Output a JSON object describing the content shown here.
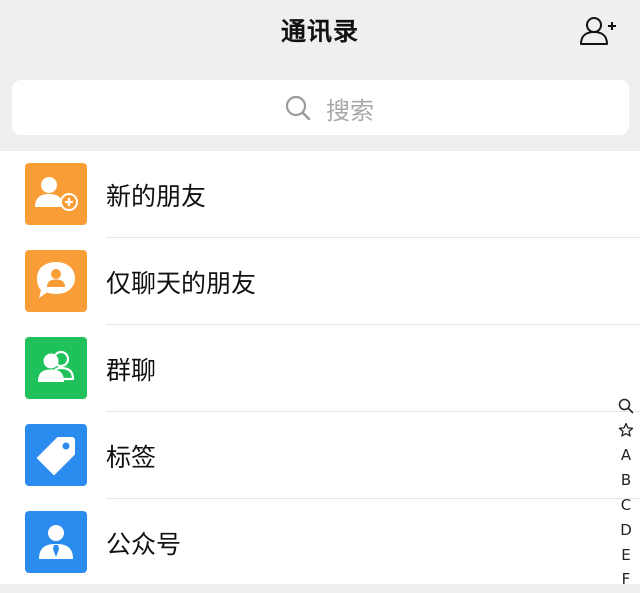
{
  "header": {
    "title": "通讯录",
    "add_icon": "add-friend-icon"
  },
  "search": {
    "placeholder": "搜索",
    "icon": "search-icon"
  },
  "items": [
    {
      "label": "新的朋友",
      "icon": "new-friend-icon",
      "color": "#f99d36"
    },
    {
      "label": "仅聊天的朋友",
      "icon": "chat-only-friend-icon",
      "color": "#f99d36"
    },
    {
      "label": "群聊",
      "icon": "group-chat-icon",
      "color": "#1ec15a"
    },
    {
      "label": "标签",
      "icon": "tag-icon",
      "color": "#2b8cf0"
    },
    {
      "label": "公众号",
      "icon": "official-account-icon",
      "color": "#2b8cf0"
    }
  ],
  "index_bar": {
    "entries": [
      "search",
      "star",
      "A",
      "B",
      "C",
      "D",
      "E",
      "F"
    ],
    "icons": {
      "search": "search-icon",
      "star": "star-icon"
    }
  }
}
